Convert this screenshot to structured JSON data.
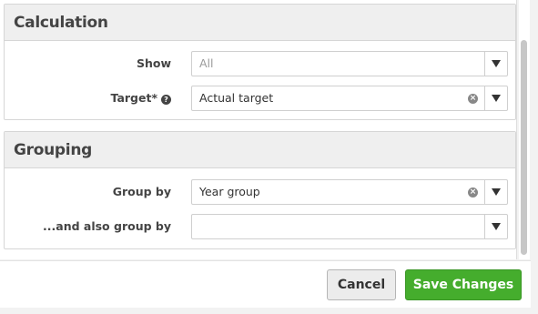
{
  "calculation": {
    "title": "Calculation",
    "show": {
      "label": "Show",
      "placeholder": "All"
    },
    "target": {
      "label": "Target*",
      "value": "Actual target",
      "help_icon": "question-circle-icon"
    }
  },
  "grouping": {
    "title": "Grouping",
    "group_by": {
      "label": "Group by",
      "value": "Year group"
    },
    "also_group_by": {
      "label": "...and also group by",
      "value": ""
    }
  },
  "footer": {
    "cancel_label": "Cancel",
    "save_label": "Save Changes"
  },
  "colors": {
    "primary": "#45ad2d",
    "section_header_bg": "#efefef"
  }
}
